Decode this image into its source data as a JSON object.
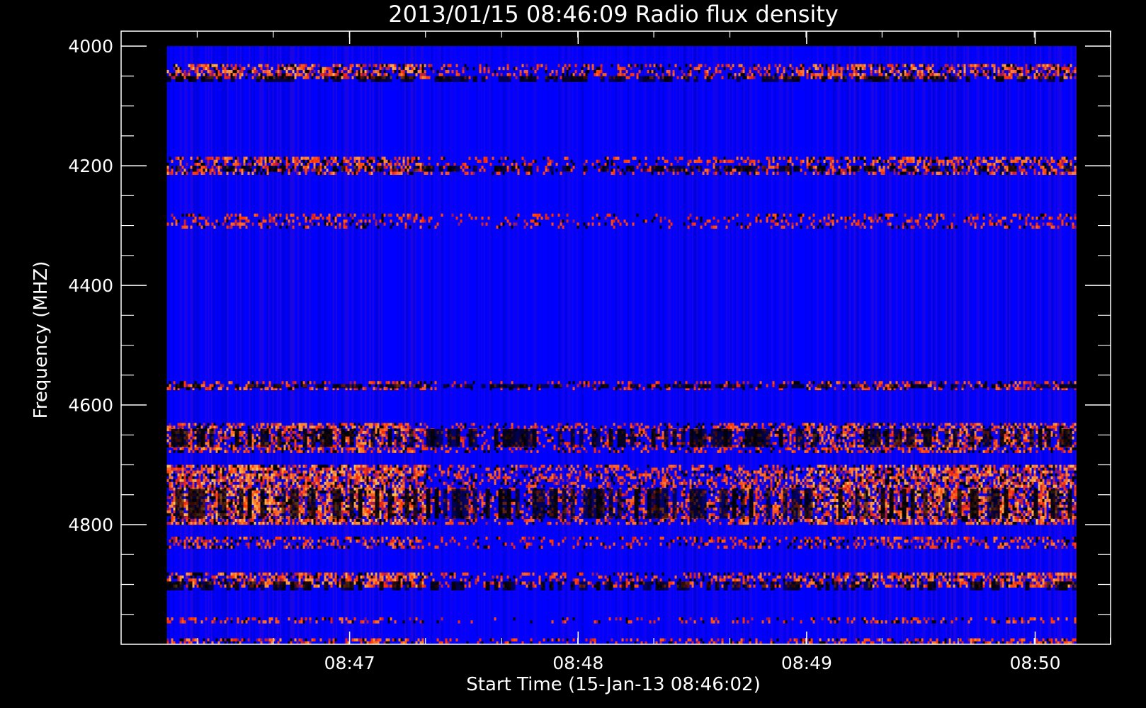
{
  "chart_data": {
    "type": "heatmap",
    "title": "2013/01/15 08:46:09 Radio flux density",
    "xlabel": "Start Time (15-Jan-13 08:46:02)",
    "ylabel": "Frequency (MHZ)",
    "x_start_label": "08:46:02",
    "x_range_minutes": [
      0.0,
      4.33
    ],
    "x_data_extent_minutes": [
      0.2,
      4.18
    ],
    "x_ticks": [
      {
        "label": "08:47",
        "minute": 1.0
      },
      {
        "label": "08:48",
        "minute": 2.0
      },
      {
        "label": "08:49",
        "minute": 3.0
      },
      {
        "label": "08:50",
        "minute": 4.0
      }
    ],
    "x_minor_step_minutes": 0.333,
    "ylim": [
      3975,
      5000
    ],
    "y_data_extent": [
      4000,
      5000
    ],
    "y_inverted": true,
    "y_ticks": [
      4000,
      4200,
      4400,
      4600,
      4800
    ],
    "y_minor_step": 50,
    "colors": {
      "background": "#000000",
      "axes": "#ffffff",
      "low": "#0000ff",
      "mid": "#ff2a00",
      "high": "#ffe060",
      "dark": "#000000"
    },
    "regimes": [
      {
        "from_minute": 0.2,
        "to_minute": 1.33,
        "activity": 0.85
      },
      {
        "from_minute": 1.33,
        "to_minute": 1.63,
        "activity": 0.35
      },
      {
        "from_minute": 1.63,
        "to_minute": 2.5,
        "activity": 0.45
      },
      {
        "from_minute": 2.5,
        "to_minute": 3.0,
        "activity": 0.55
      },
      {
        "from_minute": 3.0,
        "to_minute": 4.18,
        "activity": 0.8
      }
    ],
    "bands": [
      {
        "from": 4030,
        "to": 4055,
        "intensity": 0.9
      },
      {
        "from": 4185,
        "to": 4215,
        "intensity": 0.75
      },
      {
        "from": 4280,
        "to": 4305,
        "intensity": 0.45
      },
      {
        "from": 4560,
        "to": 4575,
        "intensity": 0.6
      },
      {
        "from": 4630,
        "to": 4680,
        "intensity": 0.8
      },
      {
        "from": 4700,
        "to": 4800,
        "intensity": 1.0
      },
      {
        "from": 4820,
        "to": 4840,
        "intensity": 0.6
      },
      {
        "from": 4880,
        "to": 4905,
        "intensity": 0.85
      },
      {
        "from": 4955,
        "to": 4965,
        "intensity": 0.5
      },
      {
        "from": 4990,
        "to": 5000,
        "intensity": 0.7
      }
    ],
    "dark_bands": [
      {
        "from": 4050,
        "to": 4060
      },
      {
        "from": 4200,
        "to": 4210
      },
      {
        "from": 4565,
        "to": 4572
      },
      {
        "from": 4640,
        "to": 4670
      },
      {
        "from": 4740,
        "to": 4790
      },
      {
        "from": 4895,
        "to": 4910
      }
    ]
  }
}
